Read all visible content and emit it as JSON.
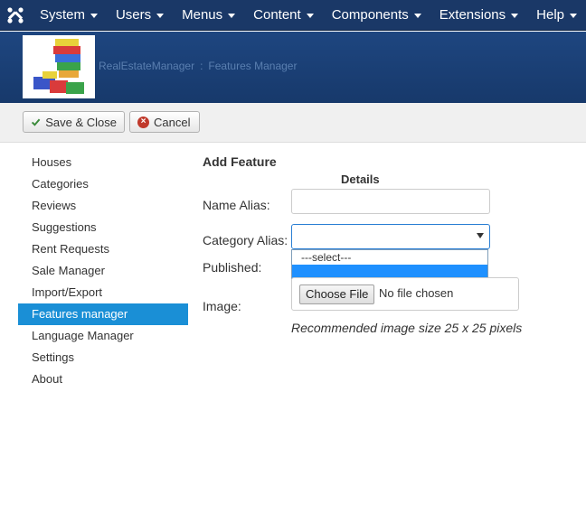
{
  "navbar": {
    "logo_icon": "joomla-icon",
    "menus": [
      {
        "label": "System"
      },
      {
        "label": "Users"
      },
      {
        "label": "Menus"
      },
      {
        "label": "Content"
      },
      {
        "label": "Components"
      },
      {
        "label": "Extensions"
      },
      {
        "label": "Help"
      }
    ]
  },
  "header": {
    "component": "RealEstateManager",
    "separator": ":",
    "page": "Features Manager"
  },
  "toolbar": {
    "save_close_label": "Save & Close",
    "cancel_label": "Cancel"
  },
  "sidebar": {
    "items": [
      {
        "label": "Houses"
      },
      {
        "label": "Categories"
      },
      {
        "label": "Reviews"
      },
      {
        "label": "Suggestions"
      },
      {
        "label": "Rent Requests"
      },
      {
        "label": "Sale Manager"
      },
      {
        "label": "Import/Export"
      },
      {
        "label": "Features manager",
        "active": true
      },
      {
        "label": "Language Manager"
      },
      {
        "label": "Settings"
      },
      {
        "label": "About"
      }
    ]
  },
  "form": {
    "title": "Add Feature",
    "subtitle": "Details",
    "name_alias_label": "Name Alias:",
    "name_alias_value": "",
    "category_alias_label": "Category Alias:",
    "category_options": [
      "---select---",
      ""
    ],
    "published_label": "Published:",
    "image_label": "Image:",
    "choose_file_label": "Choose File",
    "no_file_text": "No file chosen",
    "image_hint": "Recommended image size 25 x 25 pixels"
  },
  "colors": {
    "navbar_bg": "#1a3867",
    "header_bg": "#1e4680",
    "active_item": "#1a8fd6",
    "dropdown_highlight": "#1e90ff"
  }
}
